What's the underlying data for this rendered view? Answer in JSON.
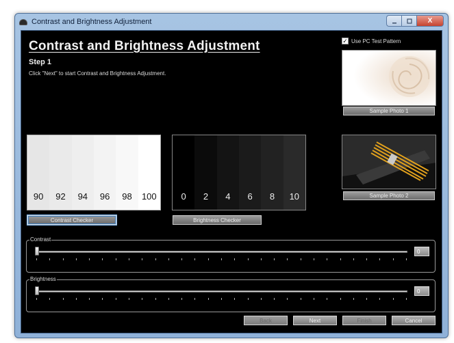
{
  "window": {
    "title": "Contrast and Brightness Adjustment",
    "close_symbol": "X"
  },
  "page": {
    "heading": "Contrast and Brightness Adjustment",
    "step": "Step 1",
    "instruction": "Click \"Next\" to start Contrast and Brightness Adjustment."
  },
  "pc_test_pattern": {
    "label": "Use PC Test Pattern",
    "checked": true,
    "check_symbol": "✓"
  },
  "samples": {
    "photo1_button": "Sample Photo 1",
    "photo2_button": "Sample Photo 2"
  },
  "contrast_checker": {
    "levels": [
      "90",
      "92",
      "94",
      "96",
      "98",
      "100"
    ],
    "button": "Contrast Checker"
  },
  "brightness_checker": {
    "levels": [
      "0",
      "2",
      "4",
      "6",
      "8",
      "10"
    ],
    "button": "Brightness Checker"
  },
  "contrast": {
    "label": "Contrast",
    "value": "0"
  },
  "brightness": {
    "label": "Brightness",
    "value": "0"
  },
  "buttons": {
    "back": "Back",
    "next": "Next",
    "finish": "Finish",
    "cancel": "Cancel"
  },
  "colors": {
    "contrast_shades": [
      "#e6e6e6",
      "#eaeaea",
      "#eeeeee",
      "#f3f3f3",
      "#f8f8f8",
      "#ffffff"
    ],
    "brightness_shades": [
      "#000000",
      "#0b0b0b",
      "#141414",
      "#1b1b1b",
      "#222222",
      "#2a2a2a"
    ]
  }
}
